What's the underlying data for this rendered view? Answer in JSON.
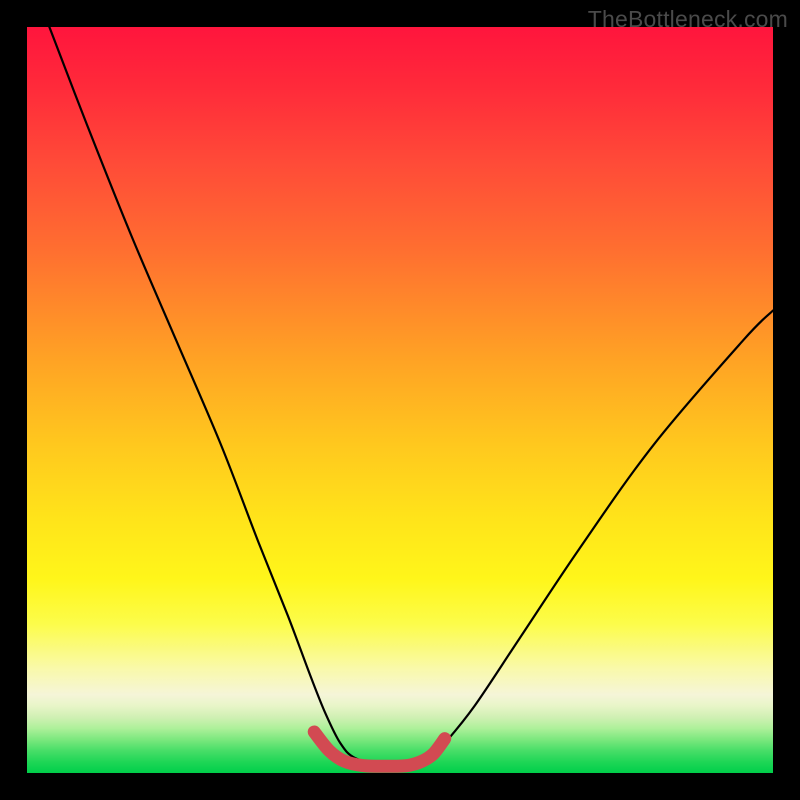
{
  "watermark": {
    "text": "TheBottleneck.com"
  },
  "chart_data": {
    "type": "line",
    "title": "",
    "xlabel": "",
    "ylabel": "",
    "xlim": [
      0,
      100
    ],
    "ylim": [
      0,
      100
    ],
    "series": [
      {
        "name": "black-curve",
        "stroke": "#000000",
        "stroke_width": 2.2,
        "x": [
          3,
          8,
          14,
          20,
          26,
          31,
          35,
          38,
          40,
          42,
          44,
          48,
          52,
          54,
          56,
          60,
          66,
          74,
          84,
          96,
          100
        ],
        "y": [
          100,
          87,
          72,
          58,
          44,
          31,
          21,
          13,
          8,
          4,
          2,
          1,
          1,
          2,
          4,
          9,
          18,
          30,
          44,
          58,
          62
        ]
      },
      {
        "name": "red-highlight",
        "stroke": "#d24a52",
        "stroke_width": 13,
        "x": [
          38.5,
          40.5,
          42.5,
          45,
          48,
          51,
          53,
          54.5,
          56
        ],
        "y": [
          5.5,
          3.0,
          1.6,
          1.0,
          0.9,
          1.0,
          1.6,
          2.6,
          4.6
        ]
      }
    ],
    "gradient_stops": [
      {
        "pos": 0,
        "color": "#ff153d"
      },
      {
        "pos": 30,
        "color": "#ff6f30"
      },
      {
        "pos": 66,
        "color": "#ffe41a"
      },
      {
        "pos": 89,
        "color": "#f5f5d8"
      },
      {
        "pos": 100,
        "color": "#00cf4a"
      }
    ]
  }
}
